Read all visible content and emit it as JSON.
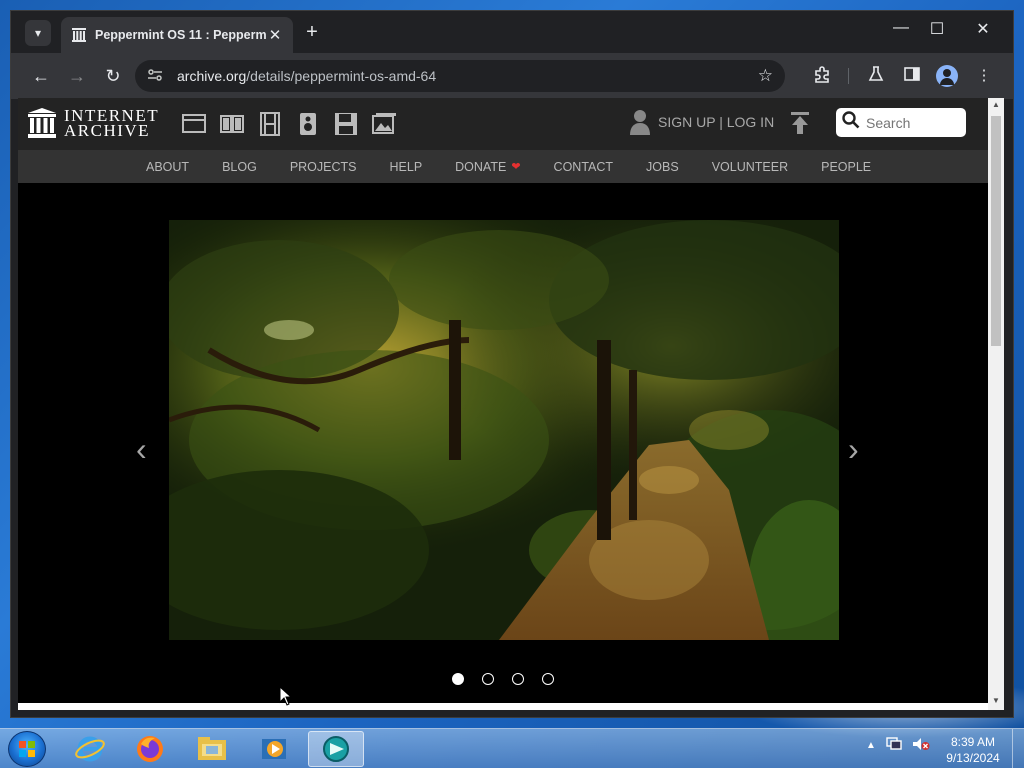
{
  "browser": {
    "tab_title": "Peppermint OS 11 : Peppermint",
    "url_domain": "archive.org",
    "url_path": "/details/peppermint-os-amd-64"
  },
  "ia": {
    "logo_line1": "INTERNET",
    "logo_line2": "ARCHIVE",
    "signup_text": "SIGN UP | LOG IN",
    "search_placeholder": "Search",
    "nav": [
      "ABOUT",
      "BLOG",
      "PROJECTS",
      "HELP",
      "DONATE",
      "CONTACT",
      "JOBS",
      "VOLUNTEER",
      "PEOPLE"
    ]
  },
  "carousel": {
    "slide_count": 4,
    "active_slide": 1,
    "prev_glyph": "‹",
    "next_glyph": "›"
  },
  "taskbar": {
    "time": "8:39 AM",
    "date": "9/13/2024",
    "apps": [
      "internet-explorer",
      "firefox",
      "file-explorer",
      "media-player",
      "app-active"
    ]
  },
  "colors": {
    "accent_heart": "#e53030",
    "header_bg": "#232323",
    "nav_bg": "#333333"
  }
}
